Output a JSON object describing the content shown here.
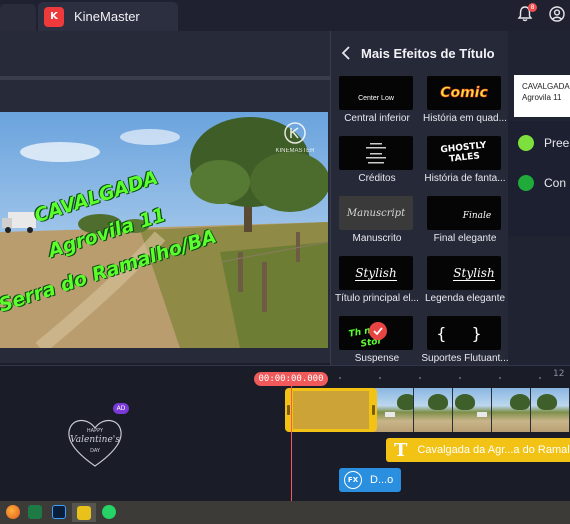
{
  "window": {
    "app_title": "KineMaster",
    "app_logo_letter": "K",
    "notification_count": "8"
  },
  "video": {
    "overlay_line1": "CAVALGADA",
    "overlay_line2": "Agrovila 11",
    "overlay_line3": "Serra do Ramalho/BA",
    "watermark": "KINEMASTER"
  },
  "effects_panel": {
    "title": "Mais Efeitos de Título",
    "items": [
      {
        "label": "Central inferior",
        "thumb_text": "Center Low",
        "icon": "center-low-thumb"
      },
      {
        "label": "História em quad...",
        "thumb_text": "Comic",
        "icon": "comic-thumb"
      },
      {
        "label": "Créditos",
        "thumb_text": "",
        "icon": "credits-thumb"
      },
      {
        "label": "História de fanta...",
        "thumb_text": "GHOSTLY TALES",
        "icon": "ghostly-thumb"
      },
      {
        "label": "Manuscrito",
        "thumb_text": "Manuscript",
        "icon": "manuscript-thumb"
      },
      {
        "label": "Final elegante",
        "thumb_text": "Finale",
        "icon": "finale-thumb"
      },
      {
        "label": "Título principal el...",
        "thumb_text": "Stylish",
        "icon": "stylish-thumb"
      },
      {
        "label": "Legenda elegante",
        "thumb_text": "Stylish",
        "icon": "stylish-caption-thumb"
      },
      {
        "label": "Suspense",
        "thumb_text": "",
        "icon": "suspense-thumb"
      },
      {
        "label": "Suportes Flutuant...",
        "thumb_text": "{ }",
        "icon": "brackets-thumb"
      }
    ]
  },
  "options_panel": {
    "preview_line1": "CAVALGADA",
    "preview_line2": "Agrovila 11",
    "option1": "Pree",
    "option2": "Con",
    "colors": {
      "option1": "#7ee03c",
      "option2": "#1faa3a"
    }
  },
  "timeline": {
    "timecode": "00:00:00.000",
    "ruler_label": "12",
    "text_layer_label": "Cavalgada da Agr...a do Ramalho/BA",
    "fx_layer_label": "D...o",
    "asset_badge": "AD",
    "asset_text1": "HAPPY",
    "asset_text2": "Valentine's",
    "asset_text3": "DAY"
  },
  "colors": {
    "accent_red": "#f05a5a",
    "clip_yellow": "#f2c314",
    "fx_blue": "#2b8fe0",
    "overlay_green": "#5cff2e"
  }
}
